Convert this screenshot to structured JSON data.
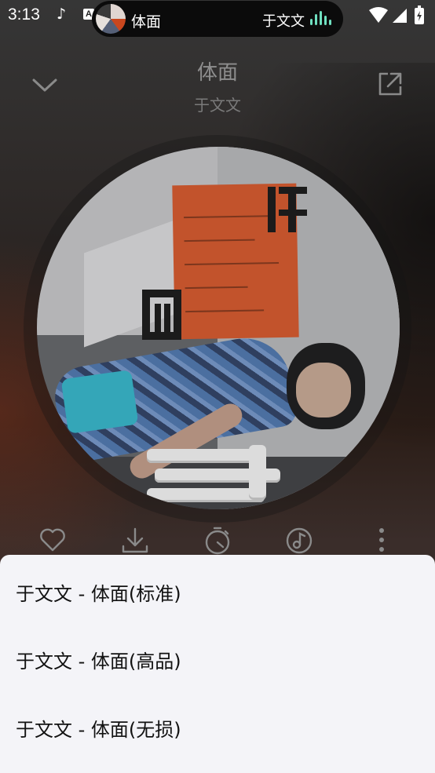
{
  "status_bar": {
    "time": "3:13",
    "music_icon": "music-note-icon",
    "a_icon": "A",
    "now_playing_title": "体面",
    "now_playing_artist": "于文文",
    "wave_color": "#6fe0c0"
  },
  "header": {
    "song_title": "体面",
    "artist": "于文文",
    "collapse_icon": "chevron-down-icon",
    "share_icon": "open-external-icon"
  },
  "actions": [
    {
      "icon": "heart-icon"
    },
    {
      "icon": "download-icon"
    },
    {
      "icon": "timer-icon"
    },
    {
      "icon": "sound-effect-icon"
    },
    {
      "icon": "more-vertical-icon"
    }
  ],
  "quality_sheet": {
    "options": [
      "于文文 - 体面(标准)",
      "于文文 - 体面(高品)",
      "于文文 - 体面(无损)"
    ]
  }
}
